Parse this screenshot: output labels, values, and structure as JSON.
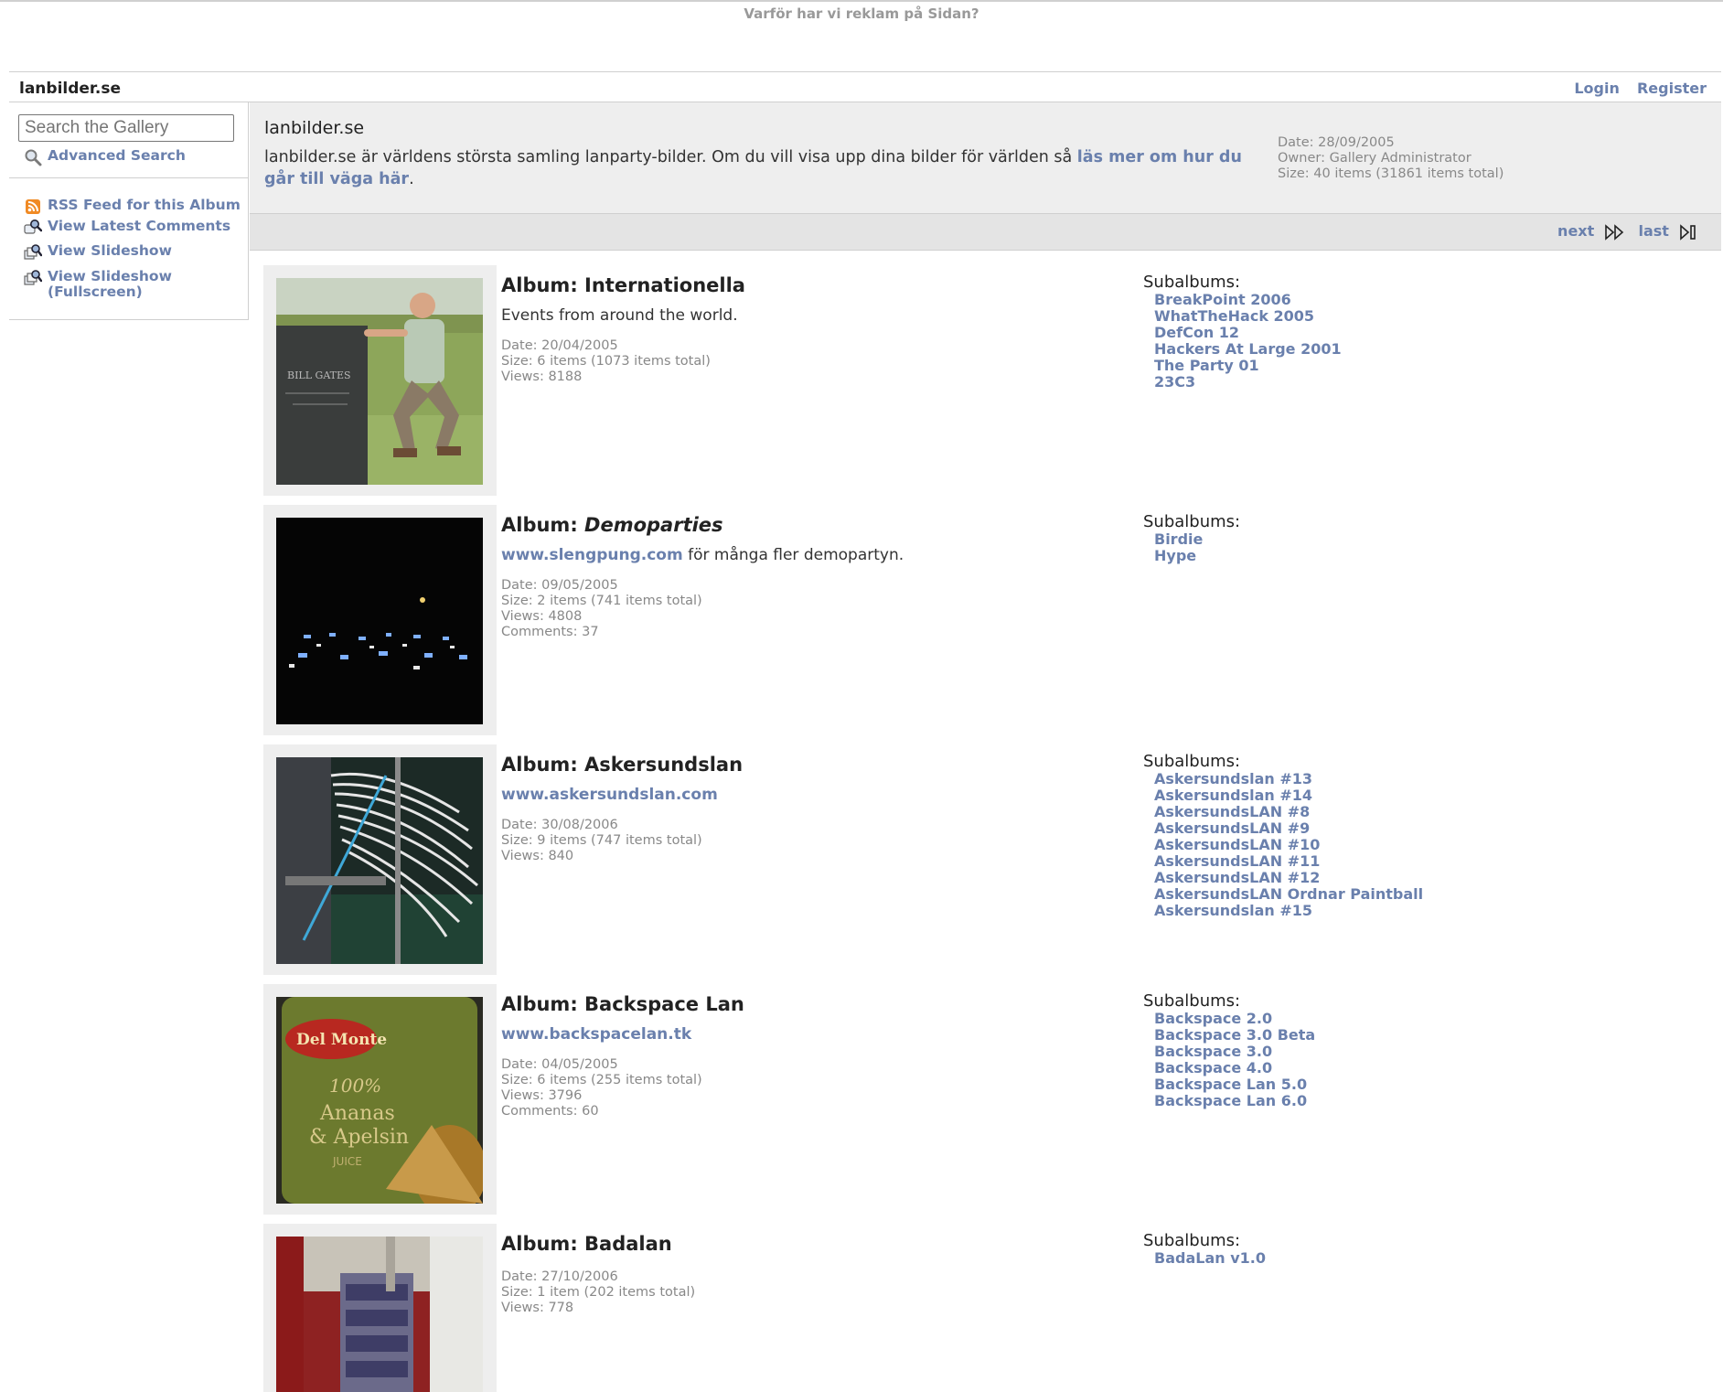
{
  "ad_text": "Varför har vi reklam på Sidan?",
  "header": {
    "site_title": "lanbilder.se",
    "login": "Login",
    "register": "Register"
  },
  "sidebar": {
    "search_placeholder": "Search the Gallery",
    "advanced_search": "Advanced Search",
    "rss": "RSS Feed for this Album",
    "latest_comments": "View Latest Comments",
    "slideshow": "View Slideshow",
    "slideshow_full_1": "View Slideshow",
    "slideshow_full_2": "(Fullscreen)"
  },
  "album_head": {
    "title": "lanbilder.se",
    "desc_pre": "lanbilder.se är världens största samling lanparty-bilder. Om du vill visa upp dina bilder för världen så ",
    "desc_link": "läs mer om hur du går till väga här",
    "desc_post": ".",
    "date": "Date: 28/09/2005",
    "owner": "Owner: Gallery Administrator",
    "size": "Size: 40 items (31861 items total)"
  },
  "nav": {
    "next": "next",
    "last": "last"
  },
  "subalbums_label": "Subalbums:",
  "albums": [
    {
      "title_prefix": "Album: ",
      "title": "Internationella",
      "desc_text": "Events from around the world.",
      "date": "Date: 20/04/2005",
      "size": "Size: 6 items (1073 items total)",
      "views": "Views: 8188",
      "subalbums": [
        "BreakPoint 2006",
        "WhatTheHack 2005",
        "DefCon 12",
        "Hackers At Large 2001",
        "The Party 01",
        "23C3"
      ]
    },
    {
      "title_prefix": "Album: ",
      "title": "Demoparties",
      "desc_link": "www.slengpung.com",
      "desc_text": " för många fler demopartyn.",
      "date": "Date: 09/05/2005",
      "size": "Size: 2 items (741 items total)",
      "views": "Views: 4808",
      "comments": "Comments: 37",
      "subalbums": [
        "Birdie",
        "Hype"
      ]
    },
    {
      "title_prefix": "Album: ",
      "title": "Askersundslan",
      "desc_link": "www.askersundslan.com",
      "date": "Date: 30/08/2006",
      "size": "Size: 9 items (747 items total)",
      "views": "Views: 840",
      "subalbums": [
        "Askersundslan #13",
        "Askersundslan #14",
        "AskersundsLAN #8",
        "AskersundsLAN #9",
        "AskersundsLAN #10",
        "AskersundsLAN #11",
        "AskersundsLAN #12",
        "AskersundsLAN Ordnar Paintball",
        "Askersundslan #15"
      ]
    },
    {
      "title_prefix": "Album: ",
      "title": "Backspace Lan",
      "desc_link": "www.backspacelan.tk",
      "date": "Date: 04/05/2005",
      "size": "Size: 6 items (255 items total)",
      "views": "Views: 3796",
      "comments": "Comments: 60",
      "subalbums": [
        "Backspace 2.0",
        "Backspace 3.0 Beta",
        "Backspace 3.0",
        "Backspace 4.0",
        "Backspace Lan 5.0",
        "Backspace Lan 6.0"
      ]
    },
    {
      "title_prefix": "Album: ",
      "title": "Badalan",
      "date": "Date: 27/10/2006",
      "size": "Size: 1 item (202 items total)",
      "views": "Views: 778",
      "subalbums": [
        "BadaLan v1.0"
      ]
    }
  ],
  "thumb_labels": {
    "grave": "BILL GATES",
    "can_brand": "Del Monte",
    "can_line1": "100%",
    "can_line2": "Ananas",
    "can_line3": "& Apelsin",
    "can_line4": "JUICE"
  }
}
